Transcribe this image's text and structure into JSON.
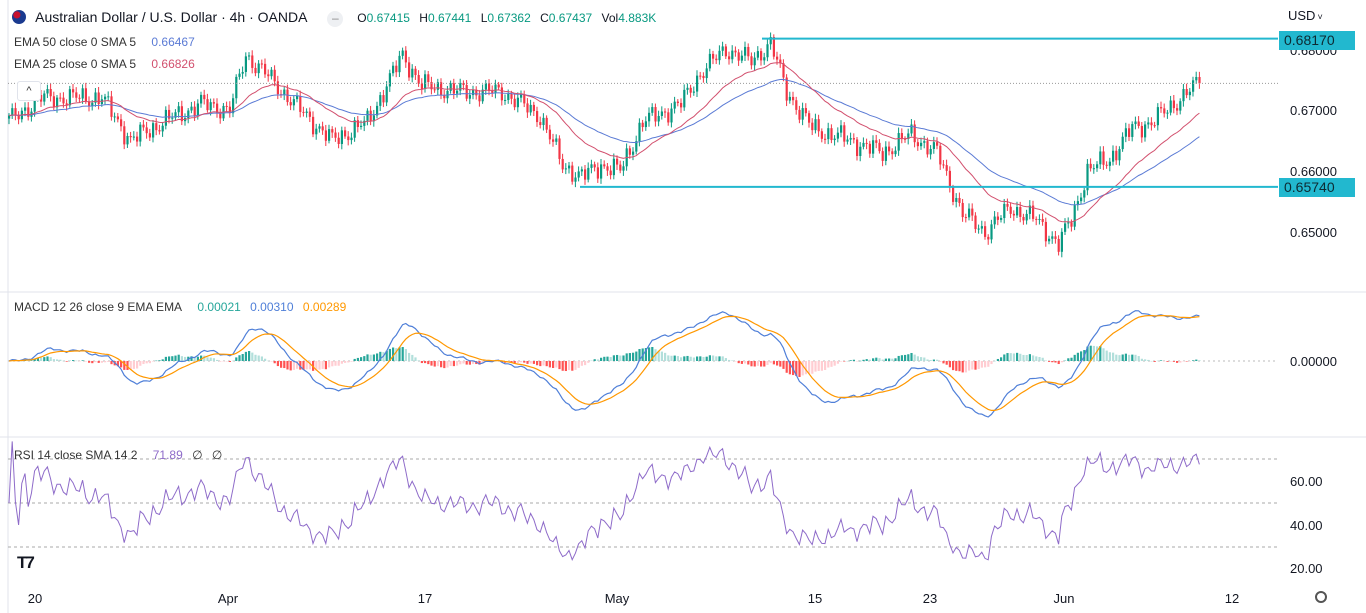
{
  "header": {
    "symbol_title": "Australian Dollar / U.S. Dollar · 4h · OANDA",
    "ohlc": [
      {
        "label": "O",
        "value": "0.67415"
      },
      {
        "label": "H",
        "value": "0.67441"
      },
      {
        "label": "L",
        "value": "0.67362"
      },
      {
        "label": "C",
        "value": "0.67437"
      }
    ],
    "volume": {
      "label": "Vol",
      "value": "4.883K"
    },
    "currency": "USD",
    "collapse_icon": "chevron-up-icon"
  },
  "indicators": {
    "ema50": {
      "label": "EMA 50 close 0 SMA 5",
      "value": "0.66467",
      "color": "#5b7bd5"
    },
    "ema25": {
      "label": "EMA 25 close 0 SMA 5",
      "value": "0.66826",
      "color": "#d2506e"
    },
    "macd": {
      "label": "MACD 12 26 close 9 EMA EMA",
      "hist": "0.00021",
      "macd": "0.00310",
      "signal": "0.00289"
    },
    "rsi": {
      "label": "RSI 14 close SMA 14 2",
      "value": "71.89",
      "extra1": "∅",
      "extra2": "∅"
    }
  },
  "price_axis": {
    "ticks": [
      "0.68000",
      "0.67000",
      "0.66000",
      "0.65000"
    ],
    "levels": [
      {
        "name": "resistance",
        "value": "0.68170"
      },
      {
        "name": "support",
        "value": "0.65740"
      }
    ]
  },
  "macd_axis": {
    "ticks": [
      "0.00000"
    ]
  },
  "rsi_axis": {
    "ticks": [
      "60.00",
      "40.00",
      "20.00"
    ]
  },
  "time_axis": {
    "ticks": [
      "20",
      "Apr",
      "17",
      "May",
      "15",
      "23",
      "Jun",
      "12"
    ]
  },
  "colors": {
    "up": "#089981",
    "down": "#f23645",
    "level": "#22b8cf",
    "macd_line": "#4f7fd8",
    "signal_line": "#ff9800",
    "rsi_line": "#8e6bc9"
  },
  "chart_data": {
    "type": "candlestick",
    "title": "Australian Dollar / U.S. Dollar · 4h · OANDA",
    "ylim": [
      0.6455,
      0.6835
    ],
    "price_path": [
      [
        1,
        0.6685
      ],
      [
        10,
        0.672
      ],
      [
        29,
        0.672
      ],
      [
        38,
        0.665
      ],
      [
        48,
        0.668
      ],
      [
        60,
        0.671
      ],
      [
        69,
        0.67
      ],
      [
        74,
        0.679
      ],
      [
        82,
        0.675
      ],
      [
        91,
        0.67
      ],
      [
        101,
        0.665
      ],
      [
        112,
        0.668
      ],
      [
        123,
        0.679
      ],
      [
        129,
        0.674
      ],
      [
        141,
        0.673
      ],
      [
        154,
        0.673
      ],
      [
        166,
        0.669
      ],
      [
        173,
        0.661
      ],
      [
        179,
        0.659
      ],
      [
        185,
        0.661
      ],
      [
        191,
        0.66
      ],
      [
        198,
        0.668
      ],
      [
        210,
        0.671
      ],
      [
        216,
        0.676
      ],
      [
        224,
        0.68
      ],
      [
        232,
        0.678
      ],
      [
        238,
        0.681
      ],
      [
        243,
        0.673
      ],
      [
        251,
        0.667
      ],
      [
        263,
        0.665
      ],
      [
        273,
        0.663
      ],
      [
        282,
        0.666
      ],
      [
        290,
        0.663
      ],
      [
        298,
        0.653
      ],
      [
        305,
        0.65
      ],
      [
        313,
        0.654
      ],
      [
        321,
        0.652
      ],
      [
        328,
        0.648
      ],
      [
        332,
        0.652
      ],
      [
        337,
        0.66
      ],
      [
        344,
        0.662
      ],
      [
        351,
        0.667
      ],
      [
        357,
        0.668
      ],
      [
        362,
        0.67
      ],
      [
        366,
        0.672
      ],
      [
        372,
        0.6744
      ]
    ],
    "horizontal_levels": [
      0.6817,
      0.6574
    ],
    "last_price": 0.67437,
    "rsi_bands": [
      70,
      50,
      30
    ]
  }
}
